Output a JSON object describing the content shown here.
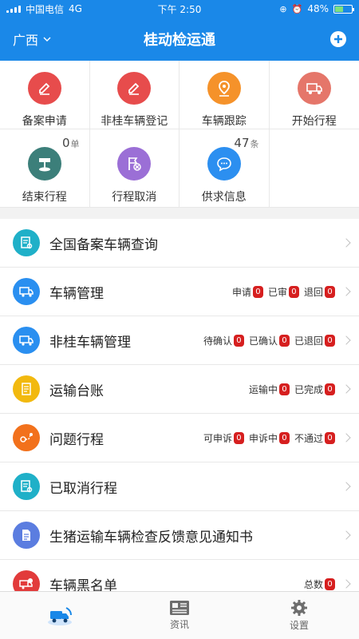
{
  "status": {
    "carrier": "中国电信",
    "network": "4G",
    "time": "下午 2:50",
    "battery": "48%",
    "battery_level": 0.48
  },
  "header": {
    "region": "广西",
    "title": "桂动检运通"
  },
  "grid": {
    "items": [
      {
        "label": "备案申请",
        "icon": "pencil-icon",
        "color": "#e74c4c"
      },
      {
        "label": "非桂车辆登记",
        "icon": "pencil-icon",
        "color": "#e74c4c"
      },
      {
        "label": "车辆跟踪",
        "icon": "location-pin-icon",
        "color": "#f5922a"
      },
      {
        "label": "开始行程",
        "icon": "truck-icon",
        "color": "#e5766a"
      },
      {
        "label": "结束行程",
        "icon": "signpost-icon",
        "color": "#3c7f7a",
        "count": "0",
        "unit": "单"
      },
      {
        "label": "行程取消",
        "icon": "flag-cancel-icon",
        "color": "#9b6fd6"
      },
      {
        "label": "供求信息",
        "icon": "chat-bubble-icon",
        "color": "#2c8ff0",
        "count": "47",
        "unit": "条"
      }
    ]
  },
  "list": {
    "rows": [
      {
        "label": "全国备案车辆查询",
        "icon": "document-search-icon",
        "color": "#1fb0c8"
      },
      {
        "label": "车辆管理",
        "icon": "truck-gear-icon",
        "color": "#2a8ff0",
        "badges": [
          {
            "label": "申请",
            "value": "0"
          },
          {
            "label": "已审",
            "value": "0"
          },
          {
            "label": "退回",
            "value": "0"
          }
        ]
      },
      {
        "label": "非桂车辆管理",
        "icon": "truck-gear-icon",
        "color": "#2a8ff0",
        "badges": [
          {
            "label": "待确认",
            "value": "0"
          },
          {
            "label": "已确认",
            "value": "0"
          },
          {
            "label": "已退回",
            "value": "0"
          }
        ]
      },
      {
        "label": "运输台账",
        "icon": "ledger-icon",
        "color": "#f2b90f",
        "badges": [
          {
            "label": "运输中",
            "value": "0"
          },
          {
            "label": "已完成",
            "value": "0"
          }
        ]
      },
      {
        "label": "问题行程",
        "icon": "problem-route-icon",
        "color": "#f2711c",
        "badges": [
          {
            "label": "可申诉",
            "value": "0"
          },
          {
            "label": "申诉中",
            "value": "0"
          },
          {
            "label": "不通过",
            "value": "0"
          }
        ]
      },
      {
        "label": "已取消行程",
        "icon": "document-cancel-icon",
        "color": "#1fb0c8"
      },
      {
        "label": "生猪运输车辆检查反馈意见通知书",
        "icon": "notice-icon",
        "color": "#5b7de0"
      },
      {
        "label": "车辆黑名单",
        "icon": "blacklist-truck-icon",
        "color": "#e23b3b",
        "badges": [
          {
            "label": "总数",
            "value": "0"
          }
        ]
      }
    ]
  },
  "tabbar": {
    "tabs": [
      {
        "label": ""
      },
      {
        "label": "资讯"
      },
      {
        "label": "设置"
      }
    ]
  }
}
